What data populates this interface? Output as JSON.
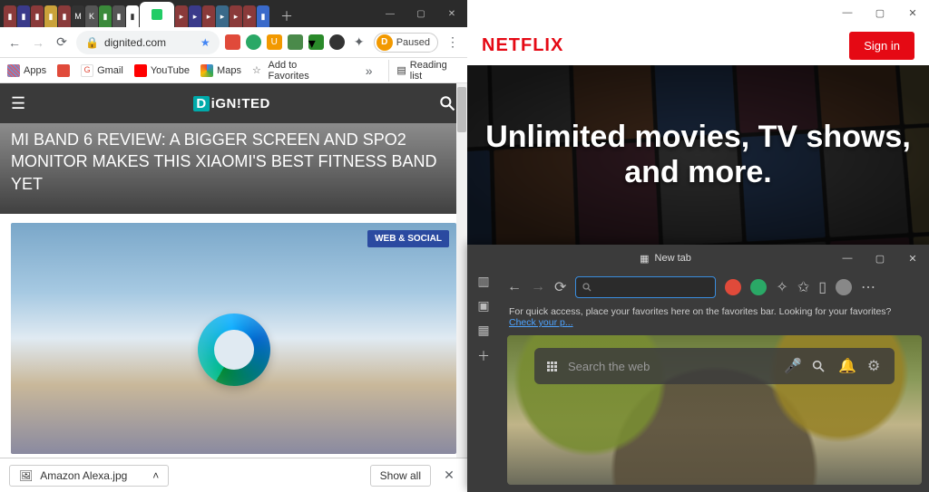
{
  "chrome": {
    "url": "dignited.com",
    "paused_label": "Paused",
    "bookmarks": {
      "apps": "Apps",
      "gmail": "Gmail",
      "youtube": "YouTube",
      "maps": "Maps",
      "add_fav": "Add to Favorites",
      "reading_list": "Reading list"
    },
    "site": {
      "logo_text": "iGN!TED",
      "headline": "MI BAND 6 REVIEW: A BIGGER SCREEN AND SPO2 MONITOR MAKES THIS XIAOMI'S BEST FITNESS BAND YET",
      "card_badge": "WEB & SOCIAL"
    },
    "download": {
      "filename": "Amazon Alexa.jpg",
      "show_all": "Show all"
    }
  },
  "netflix": {
    "logo": "NETFLIX",
    "signin": "Sign in",
    "headline": "Unlimited movies, TV shows, and more."
  },
  "edge": {
    "tab_label": "New tab",
    "info_text": "For quick access, place your favorites here on the favorites bar. Looking for your favorites?",
    "info_link": "Check your p...",
    "search_placeholder": "Search the web"
  }
}
